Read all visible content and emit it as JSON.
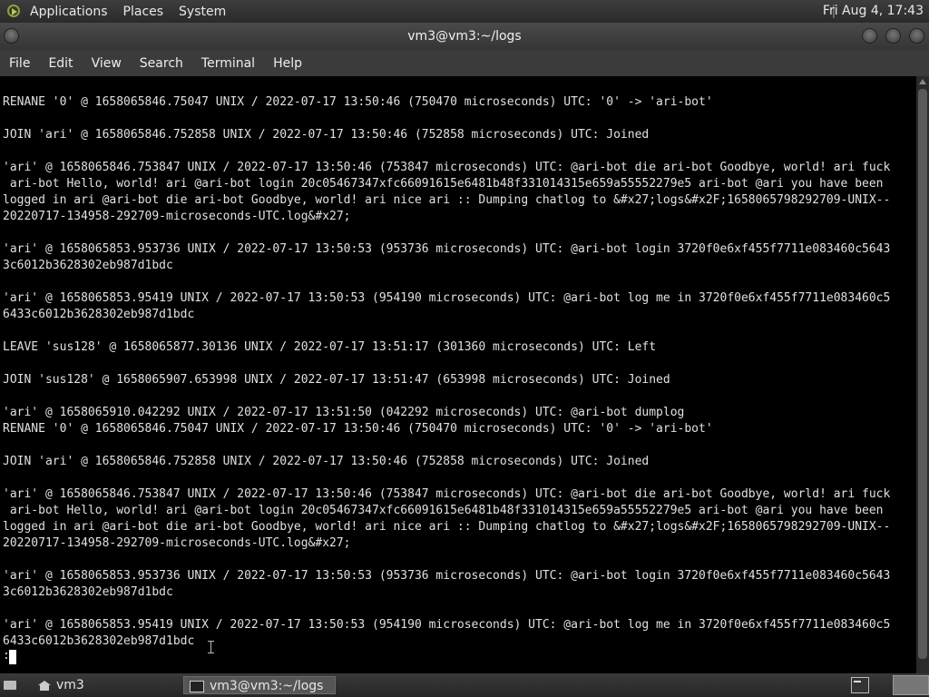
{
  "top_panel": {
    "menus": [
      "Applications",
      "Places",
      "System"
    ],
    "clock": "Fri Aug  4, 17:43"
  },
  "window": {
    "title": "vm3@vm3:~/logs"
  },
  "menu_bar": {
    "items": [
      "File",
      "Edit",
      "View",
      "Search",
      "Terminal",
      "Help"
    ]
  },
  "terminal": {
    "lines": [
      "RENANE '0' @ 1658065846.75047 UNIX / 2022-07-17 13:50:46 (750470 microseconds) UTC: '0' -> 'ari-bot'",
      "",
      "JOIN 'ari' @ 1658065846.752858 UNIX / 2022-07-17 13:50:46 (752858 microseconds) UTC: Joined",
      "",
      "'ari' @ 1658065846.753847 UNIX / 2022-07-17 13:50:46 (753847 microseconds) UTC: @ari-bot die ari-bot Goodbye, world! ari fuck",
      " ari-bot Hello, world! ari @ari-bot login 20c05467347xfc66091615e6481b48f331014315e659a55552279e5 ari-bot @ari you have been",
      "logged in ari @ari-bot die ari-bot Goodbye, world! ari nice ari :: Dumping chatlog to &#x27;logs&#x2F;1658065798292709-UNIX--",
      "20220717-134958-292709-microseconds-UTC.log&#x27;",
      "",
      "'ari' @ 1658065853.953736 UNIX / 2022-07-17 13:50:53 (953736 microseconds) UTC: @ari-bot login 3720f0e6xf455f7711e083460c5643",
      "3c6012b3628302eb987d1bdc",
      "",
      "'ari' @ 1658065853.95419 UNIX / 2022-07-17 13:50:53 (954190 microseconds) UTC: @ari-bot log me in 3720f0e6xf455f7711e083460c5",
      "6433c6012b3628302eb987d1bdc",
      "",
      "LEAVE 'sus128' @ 1658065877.30136 UNIX / 2022-07-17 13:51:17 (301360 microseconds) UTC: Left",
      "",
      "JOIN 'sus128' @ 1658065907.653998 UNIX / 2022-07-17 13:51:47 (653998 microseconds) UTC: Joined",
      "",
      "'ari' @ 1658065910.042292 UNIX / 2022-07-17 13:51:50 (042292 microseconds) UTC: @ari-bot dumplog",
      "RENANE '0' @ 1658065846.75047 UNIX / 2022-07-17 13:50:46 (750470 microseconds) UTC: '0' -> 'ari-bot'",
      "",
      "JOIN 'ari' @ 1658065846.752858 UNIX / 2022-07-17 13:50:46 (752858 microseconds) UTC: Joined",
      "",
      "'ari' @ 1658065846.753847 UNIX / 2022-07-17 13:50:46 (753847 microseconds) UTC: @ari-bot die ari-bot Goodbye, world! ari fuck",
      " ari-bot Hello, world! ari @ari-bot login 20c05467347xfc66091615e6481b48f331014315e659a55552279e5 ari-bot @ari you have been",
      "logged in ari @ari-bot die ari-bot Goodbye, world! ari nice ari :: Dumping chatlog to &#x27;logs&#x2F;1658065798292709-UNIX--",
      "20220717-134958-292709-microseconds-UTC.log&#x27;",
      "",
      "'ari' @ 1658065853.953736 UNIX / 2022-07-17 13:50:53 (953736 microseconds) UTC: @ari-bot login 3720f0e6xf455f7711e083460c5643",
      "3c6012b3628302eb987d1bdc",
      "",
      "'ari' @ 1658065853.95419 UNIX / 2022-07-17 13:50:53 (954190 microseconds) UTC: @ari-bot log me in 3720f0e6xf455f7711e083460c5",
      "6433c6012b3628302eb987d1bdc"
    ],
    "prompt": ":"
  },
  "taskbar": {
    "workspace_label": "vm3",
    "active_task": "vm3@vm3:~/logs"
  }
}
